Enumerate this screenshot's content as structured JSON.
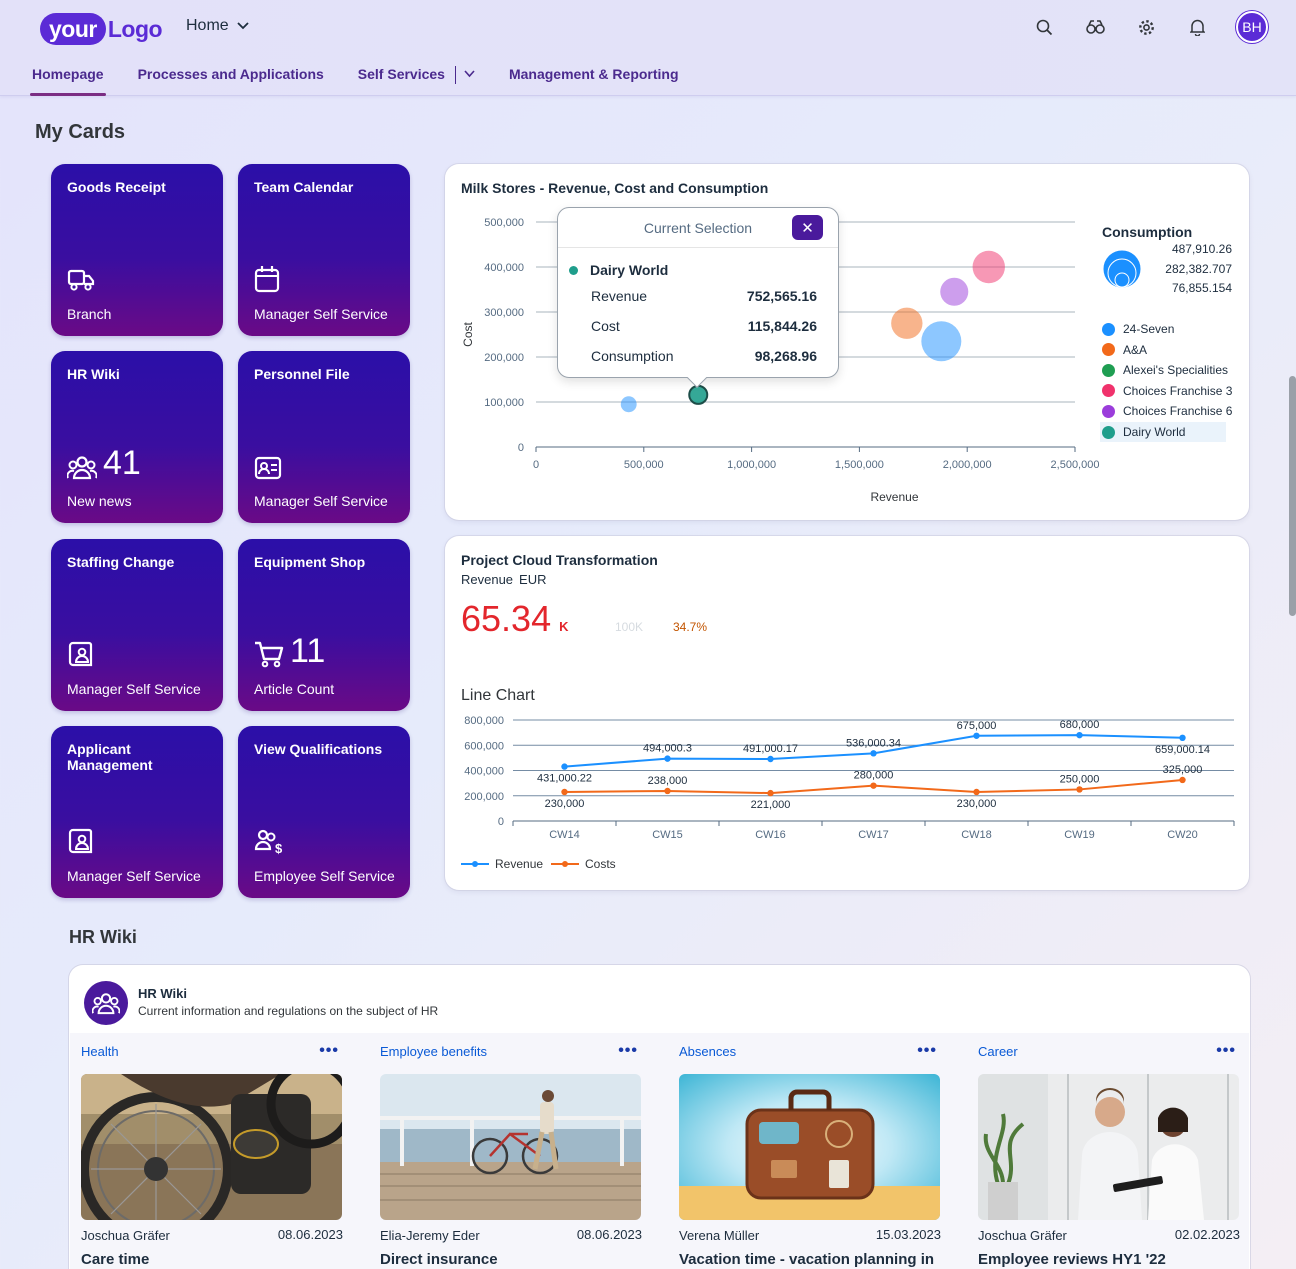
{
  "shell": {
    "logo_your": "your",
    "logo_word": "Logo",
    "home_menu": "Home",
    "avatar_initials": "BH",
    "icons": [
      "search-icon",
      "coach-icon",
      "settings-icon",
      "bell-icon"
    ]
  },
  "nav": {
    "tabs": [
      {
        "label": "Homepage",
        "active": true
      },
      {
        "label": "Processes and Applications",
        "active": false
      },
      {
        "label": "Self Services",
        "active": false,
        "menu": true
      },
      {
        "label": "Management & Reporting",
        "active": false
      }
    ]
  },
  "my_cards": {
    "title": "My Cards",
    "tiles": [
      {
        "title": "Goods Receipt",
        "icon": "truck-icon",
        "number": "",
        "subtitle": "Branch"
      },
      {
        "title": "Team Calendar",
        "icon": "calendar-icon",
        "number": "",
        "subtitle": "Manager Self Service"
      },
      {
        "title": "HR Wiki",
        "icon": "group-icon",
        "number": "41",
        "subtitle": "New news"
      },
      {
        "title": "Personnel File",
        "icon": "id-card-icon",
        "number": "",
        "subtitle": "Manager Self Service"
      },
      {
        "title": "Staffing Change",
        "icon": "person-badge-icon",
        "number": "",
        "subtitle": "Manager Self Service"
      },
      {
        "title": "Equipment Shop",
        "icon": "cart-icon",
        "number": "11",
        "subtitle": "Article Count"
      },
      {
        "title": "Applicant Management",
        "icon": "person-badge-icon",
        "number": "",
        "subtitle": "Manager Self Service"
      },
      {
        "title": "View Qualifications",
        "icon": "people-money-icon",
        "number": "",
        "subtitle": "Employee Self Service"
      }
    ]
  },
  "bubble_card": {
    "title": "Milk Stores - Revenue, Cost and Consumption",
    "popover": {
      "title": "Current Selection",
      "series": "Dairy World",
      "rows": [
        {
          "label": "Revenue",
          "value": "752,565.16"
        },
        {
          "label": "Cost",
          "value": "115,844.26"
        },
        {
          "label": "Consumption",
          "value": "98,268.96"
        }
      ]
    },
    "size_legend": {
      "title": "Consumption",
      "values": [
        "487,910.26",
        "282,382.707",
        "76,855.154"
      ]
    },
    "series_legend": [
      {
        "name": "24-Seven",
        "color": "#1b90ff",
        "selected": false
      },
      {
        "name": "A&A",
        "color": "#f2691a",
        "selected": false
      },
      {
        "name": "Alexei's Specialities",
        "color": "#1f9e52",
        "selected": false
      },
      {
        "name": "Choices Franchise 3",
        "color": "#f0326c",
        "selected": false
      },
      {
        "name": "Choices Franchise 6",
        "color": "#9b3ddb",
        "selected": false
      },
      {
        "name": "Dairy World",
        "color": "#1f9e8c",
        "selected": true
      }
    ]
  },
  "kpi_card": {
    "title": "Project Cloud Transformation",
    "subtitle_measure": "Revenue",
    "subtitle_currency": "EUR",
    "value": "65.34",
    "unit": "K",
    "target": "100K",
    "deviation": "34.7%",
    "chart_title": "Line Chart",
    "legend_revenue": "Revenue",
    "legend_costs": "Costs"
  },
  "hr_wiki": {
    "section_title": "HR Wiki",
    "card_title": "HR Wiki",
    "card_subtitle": "Current information and regulations on the subject of HR",
    "more": "•••",
    "columns": [
      {
        "category": "Health",
        "author": "Joschua Gräfer",
        "date": "08.06.2023",
        "headline": "Care time"
      },
      {
        "category": "Employee benefits",
        "author": "Elia-Jeremy Eder",
        "date": "08.06.2023",
        "headline": "Direct insurance"
      },
      {
        "category": "Absences",
        "author": "Verena Müller",
        "date": "15.03.2023",
        "headline": "Vacation time - vacation planning in"
      },
      {
        "category": "Career",
        "author": "Joschua Gräfer",
        "date": "02.02.2023",
        "headline": "Employee reviews HY1 '22"
      }
    ]
  },
  "chart_data": [
    {
      "type": "scatter",
      "title": "Milk Stores - Revenue, Cost and Consumption",
      "xlabel": "Revenue",
      "ylabel": "Cost",
      "xlim": [
        0,
        2500000
      ],
      "ylim": [
        0,
        500000
      ],
      "x_ticks": [
        "0",
        "500,000",
        "1,000,000",
        "1,500,000",
        "2,000,000",
        "2,500,000"
      ],
      "y_ticks": [
        "0",
        "100,000",
        "200,000",
        "300,000",
        "400,000",
        "500,000"
      ],
      "grid": true,
      "legend": "right",
      "series": [
        {
          "name": "24-Seven",
          "color": "#1b90ff",
          "points": [
            {
              "x": 430000,
              "y": 95000,
              "size": 76855
            },
            {
              "x": 1880000,
              "y": 235000,
              "size": 487910
            }
          ]
        },
        {
          "name": "A&A",
          "color": "#f2691a",
          "points": [
            {
              "x": 1720000,
              "y": 275000,
              "size": 300000
            }
          ]
        },
        {
          "name": "Choices Franchise 3",
          "color": "#f0326c",
          "points": [
            {
              "x": 2100000,
              "y": 400000,
              "size": 320000
            }
          ]
        },
        {
          "name": "Choices Franchise 6",
          "color": "#9b3ddb",
          "points": [
            {
              "x": 1940000,
              "y": 345000,
              "size": 240000
            }
          ]
        },
        {
          "name": "Dairy World",
          "color": "#1f9e8c",
          "points": [
            {
              "x": 752565.16,
              "y": 115844.26,
              "size": 98268.96
            }
          ]
        }
      ]
    },
    {
      "type": "line",
      "title": "Line Chart",
      "categories": [
        "CW14",
        "CW15",
        "CW16",
        "CW17",
        "CW18",
        "CW19",
        "CW20"
      ],
      "ylim": [
        0,
        800000
      ],
      "y_ticks": [
        "0",
        "200,000",
        "400,000",
        "600,000",
        "800,000"
      ],
      "grid": true,
      "legend": "bottom-left",
      "series": [
        {
          "name": "Revenue",
          "color": "#1b90ff",
          "values": [
            431000.22,
            494000.3,
            491000.17,
            536000.34,
            675000,
            680000,
            659000.14
          ],
          "labels": [
            "431,000.22",
            "494,000.3",
            "491,000.17",
            "536,000.34",
            "675,000",
            "680,000",
            "659,000.14"
          ]
        },
        {
          "name": "Costs",
          "color": "#f2691a",
          "values": [
            230000,
            238000,
            221000,
            280000,
            230000,
            250000,
            325000
          ],
          "labels": [
            "230,000",
            "238,000",
            "221,000",
            "280,000",
            "230,000",
            "250,000",
            "325,000"
          ]
        }
      ]
    }
  ]
}
